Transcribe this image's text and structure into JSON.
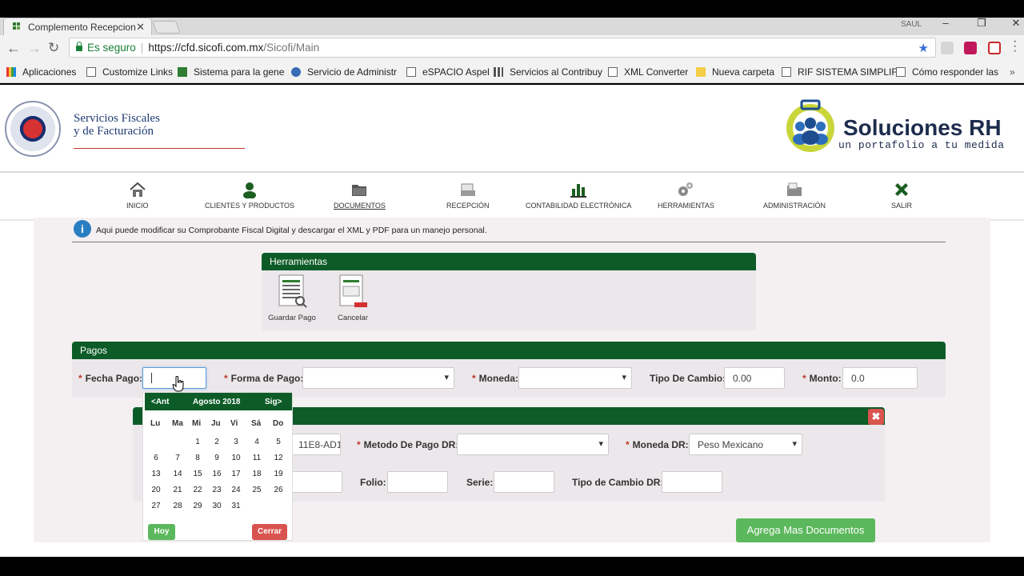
{
  "browser": {
    "tab_title": "Complemento Recepcion",
    "user_name": "SAUL",
    "secure_label": "Es seguro",
    "url_host": "https://cfd.sicofi.com.mx",
    "url_path": "/Sicofi/Main",
    "bookmarks": [
      "Aplicaciones",
      "Customize Links",
      "Sistema para la gene",
      "Servicio de Administr",
      "eSPACIO Aspel",
      "Servicios al Contribuy",
      "XML Converter",
      "Nueva carpeta",
      "RIF SISTEMA SIMPLIF",
      "Cómo responder las"
    ]
  },
  "header": {
    "brand_line1": "Servicios Fiscales",
    "brand_line2": "y de Facturación",
    "rh_title": "Soluciones RH",
    "rh_subtitle": "un portafolio a tu medida"
  },
  "nav": [
    {
      "label": "INICIO"
    },
    {
      "label": "CLIENTES Y PRODUCTOS"
    },
    {
      "label": "DOCUMENTOS"
    },
    {
      "label": "RECEPCIÓN"
    },
    {
      "label": "CONTABILIDAD ELECTRÓNICA"
    },
    {
      "label": "HERRAMIENTAS"
    },
    {
      "label": "ADMINISTRACIÓN"
    },
    {
      "label": "SALIR"
    }
  ],
  "info_text": "Aqui puede modificar su Comprobante Fiscal Digital y descargar el XML y PDF para un manejo personal.",
  "herramientas": {
    "title": "Herramientas",
    "guardar": "Guardar Pago",
    "cancelar": "Cancelar"
  },
  "pagos": {
    "title": "Pagos",
    "fecha_label": "Fecha Pago:",
    "forma_label": "Forma de Pago:",
    "moneda_label": "Moneda:",
    "tipo_cambio_label": "Tipo De Cambio:",
    "tipo_cambio_value": "0.00",
    "monto_label": "Monto:",
    "monto_value": "0.0"
  },
  "documento": {
    "uuid_partial": "11E8-AD1",
    "metodo_label": "Metodo De Pago DR:",
    "moneda_dr_label": "Moneda DR:",
    "moneda_dr_value": "Peso Mexicano",
    "folio_label": "Folio:",
    "serie_label": "Serie:",
    "tipo_cambio_dr_label": "Tipo de Cambio DR:",
    "agrega_btn": "Agrega Mas Documentos"
  },
  "datepicker": {
    "prev": "<Ant",
    "month": "Agosto 2018",
    "next": "Sig>",
    "dow": [
      "Lu",
      "Ma",
      "Mi",
      "Ju",
      "Vi",
      "Sá",
      "Do"
    ],
    "weeks": [
      [
        "",
        "",
        "1",
        "2",
        "3",
        "4",
        "5"
      ],
      [
        "6",
        "7",
        "8",
        "9",
        "10",
        "11",
        "12"
      ],
      [
        "13",
        "14",
        "15",
        "16",
        "17",
        "18",
        "19"
      ],
      [
        "20",
        "21",
        "22",
        "23",
        "24",
        "25",
        "26"
      ],
      [
        "27",
        "28",
        "29",
        "30",
        "31",
        "",
        ""
      ]
    ],
    "today_btn": "Hoy",
    "close_btn": "Cerrar"
  },
  "colors": {
    "panel_green": "#0d5c28",
    "button_green": "#5cb85c",
    "button_red": "#d9534f",
    "required_red": "#c0392b"
  }
}
